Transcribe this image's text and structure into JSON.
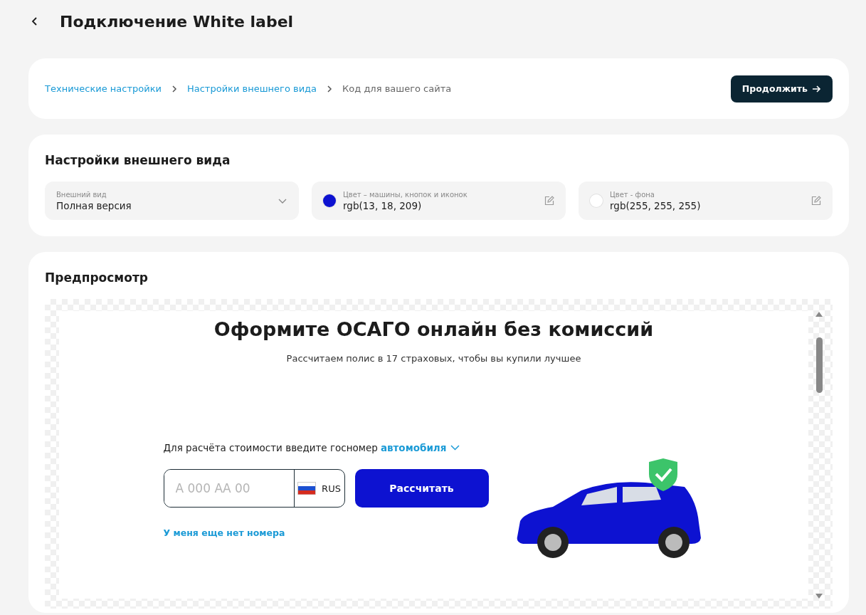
{
  "header": {
    "title": "Подключение White label"
  },
  "breadcrumbs": [
    {
      "label": "Технические настройки",
      "selected": false
    },
    {
      "label": "Настройки внешнего вида",
      "selected": false
    },
    {
      "label": "Код для вашего сайта",
      "selected": true
    }
  ],
  "continue_button": "Продолжить",
  "appearance": {
    "title": "Настройки внешнего вида",
    "fields": [
      {
        "kind": "select",
        "label": "Внешний вид",
        "value": "Полная версия"
      },
      {
        "kind": "color",
        "label": "Цвет – машины, кнопок и иконок",
        "value": "rgb(13, 18, 209)",
        "color": "#0d12d1"
      },
      {
        "kind": "color",
        "label": "Цвет - фона",
        "value": "rgb(255, 255, 255)",
        "color": "#ffffff"
      }
    ]
  },
  "preview": {
    "title": "Предпросмотр",
    "heading": "Оформите ОСАГО онлайн без комиссий",
    "subheading": "Рассчитаем полис в 17 страховых, чтобы вы купили лучшее",
    "prompt": "Для расчёта стоимости введите госномер",
    "prompt_link": "автомобиля",
    "plate_placeholder": "А 000 АА 00",
    "region": "RUS",
    "calc_button": "Рассчитать",
    "no_plate_link": "У меня еще нет номера"
  }
}
